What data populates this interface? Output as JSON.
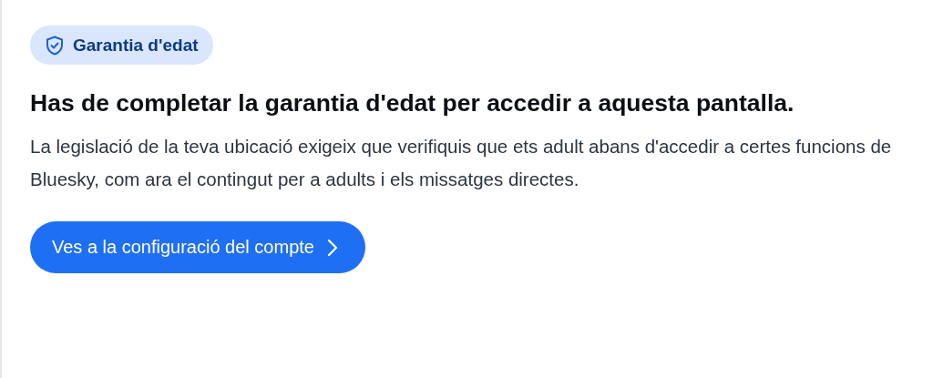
{
  "badge": {
    "label": "Garantia d'edat"
  },
  "title": "Has de completar la garantia d'edat per accedir a aquesta pantalla.",
  "description": "La legislació de la teva ubicació exigeix que verifiquis que ets adult abans d'accedir a certes funcions de Bluesky, com ara el contingut per a adults i els missatges directes.",
  "button": {
    "label": "Ves a la configuració del compte"
  }
}
